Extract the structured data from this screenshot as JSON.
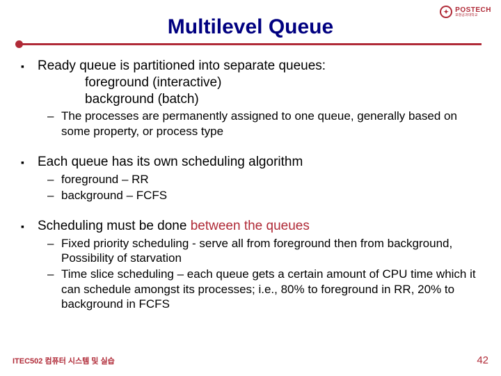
{
  "logo": {
    "main": "POSTECH",
    "sub": "포항공과대학교"
  },
  "title": "Multilevel Queue",
  "b1": {
    "main": "Ready queue is partitioned into separate queues:",
    "line1": "foreground (interactive)",
    "line2": "background (batch)",
    "sub1": "The processes are permanently assigned to one queue, generally based on some property, or process type"
  },
  "b2": {
    "main": "Each queue has its own scheduling algorithm",
    "sub1": "foreground – RR",
    "sub2": "background – FCFS"
  },
  "b3": {
    "main_pre": "Scheduling must be done ",
    "main_accent": "between the queues",
    "sub1": "Fixed priority scheduling - serve all from foreground then from background,  Possibility of starvation",
    "sub2": "Time slice scheduling – each queue gets a certain amount of CPU time which it can schedule amongst its processes; i.e., 80% to foreground in RR, 20% to background in FCFS"
  },
  "footer": {
    "left": "ITEC502 컴퓨터 시스템 및 실습",
    "page": "42"
  },
  "markers": {
    "square": "▪",
    "dash": "–"
  }
}
